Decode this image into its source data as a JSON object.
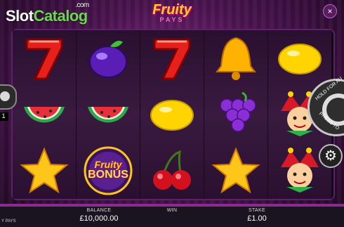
{
  "brand": {
    "part1": "Slot",
    "part2": "Catalog",
    "suffix": ".com"
  },
  "game": {
    "title_line1": "Fruity",
    "title_line2": "PAYS"
  },
  "reels": [
    [
      "seven",
      "watermelon",
      "star"
    ],
    [
      "plum",
      "watermelon",
      "fruity-bonus"
    ],
    [
      "seven",
      "lemon",
      "cherry"
    ],
    [
      "bell",
      "grapes",
      "star"
    ],
    [
      "lemon",
      "jester",
      "jester"
    ]
  ],
  "bonus_text": {
    "line1": "Fruity",
    "line2": "BONUS"
  },
  "controls": {
    "hold_label": "HOLD FOR AU",
    "press_label": "PRESS TO",
    "coin_value": "1",
    "close": "×",
    "settings": "⚙"
  },
  "bar": {
    "balance_label": "BALANCE",
    "balance_value": "£10,000.00",
    "win_label": "WIN",
    "win_value": "",
    "stake_label": "STAKE",
    "stake_value": "£1.00"
  },
  "footer_text": "Y PAYS"
}
